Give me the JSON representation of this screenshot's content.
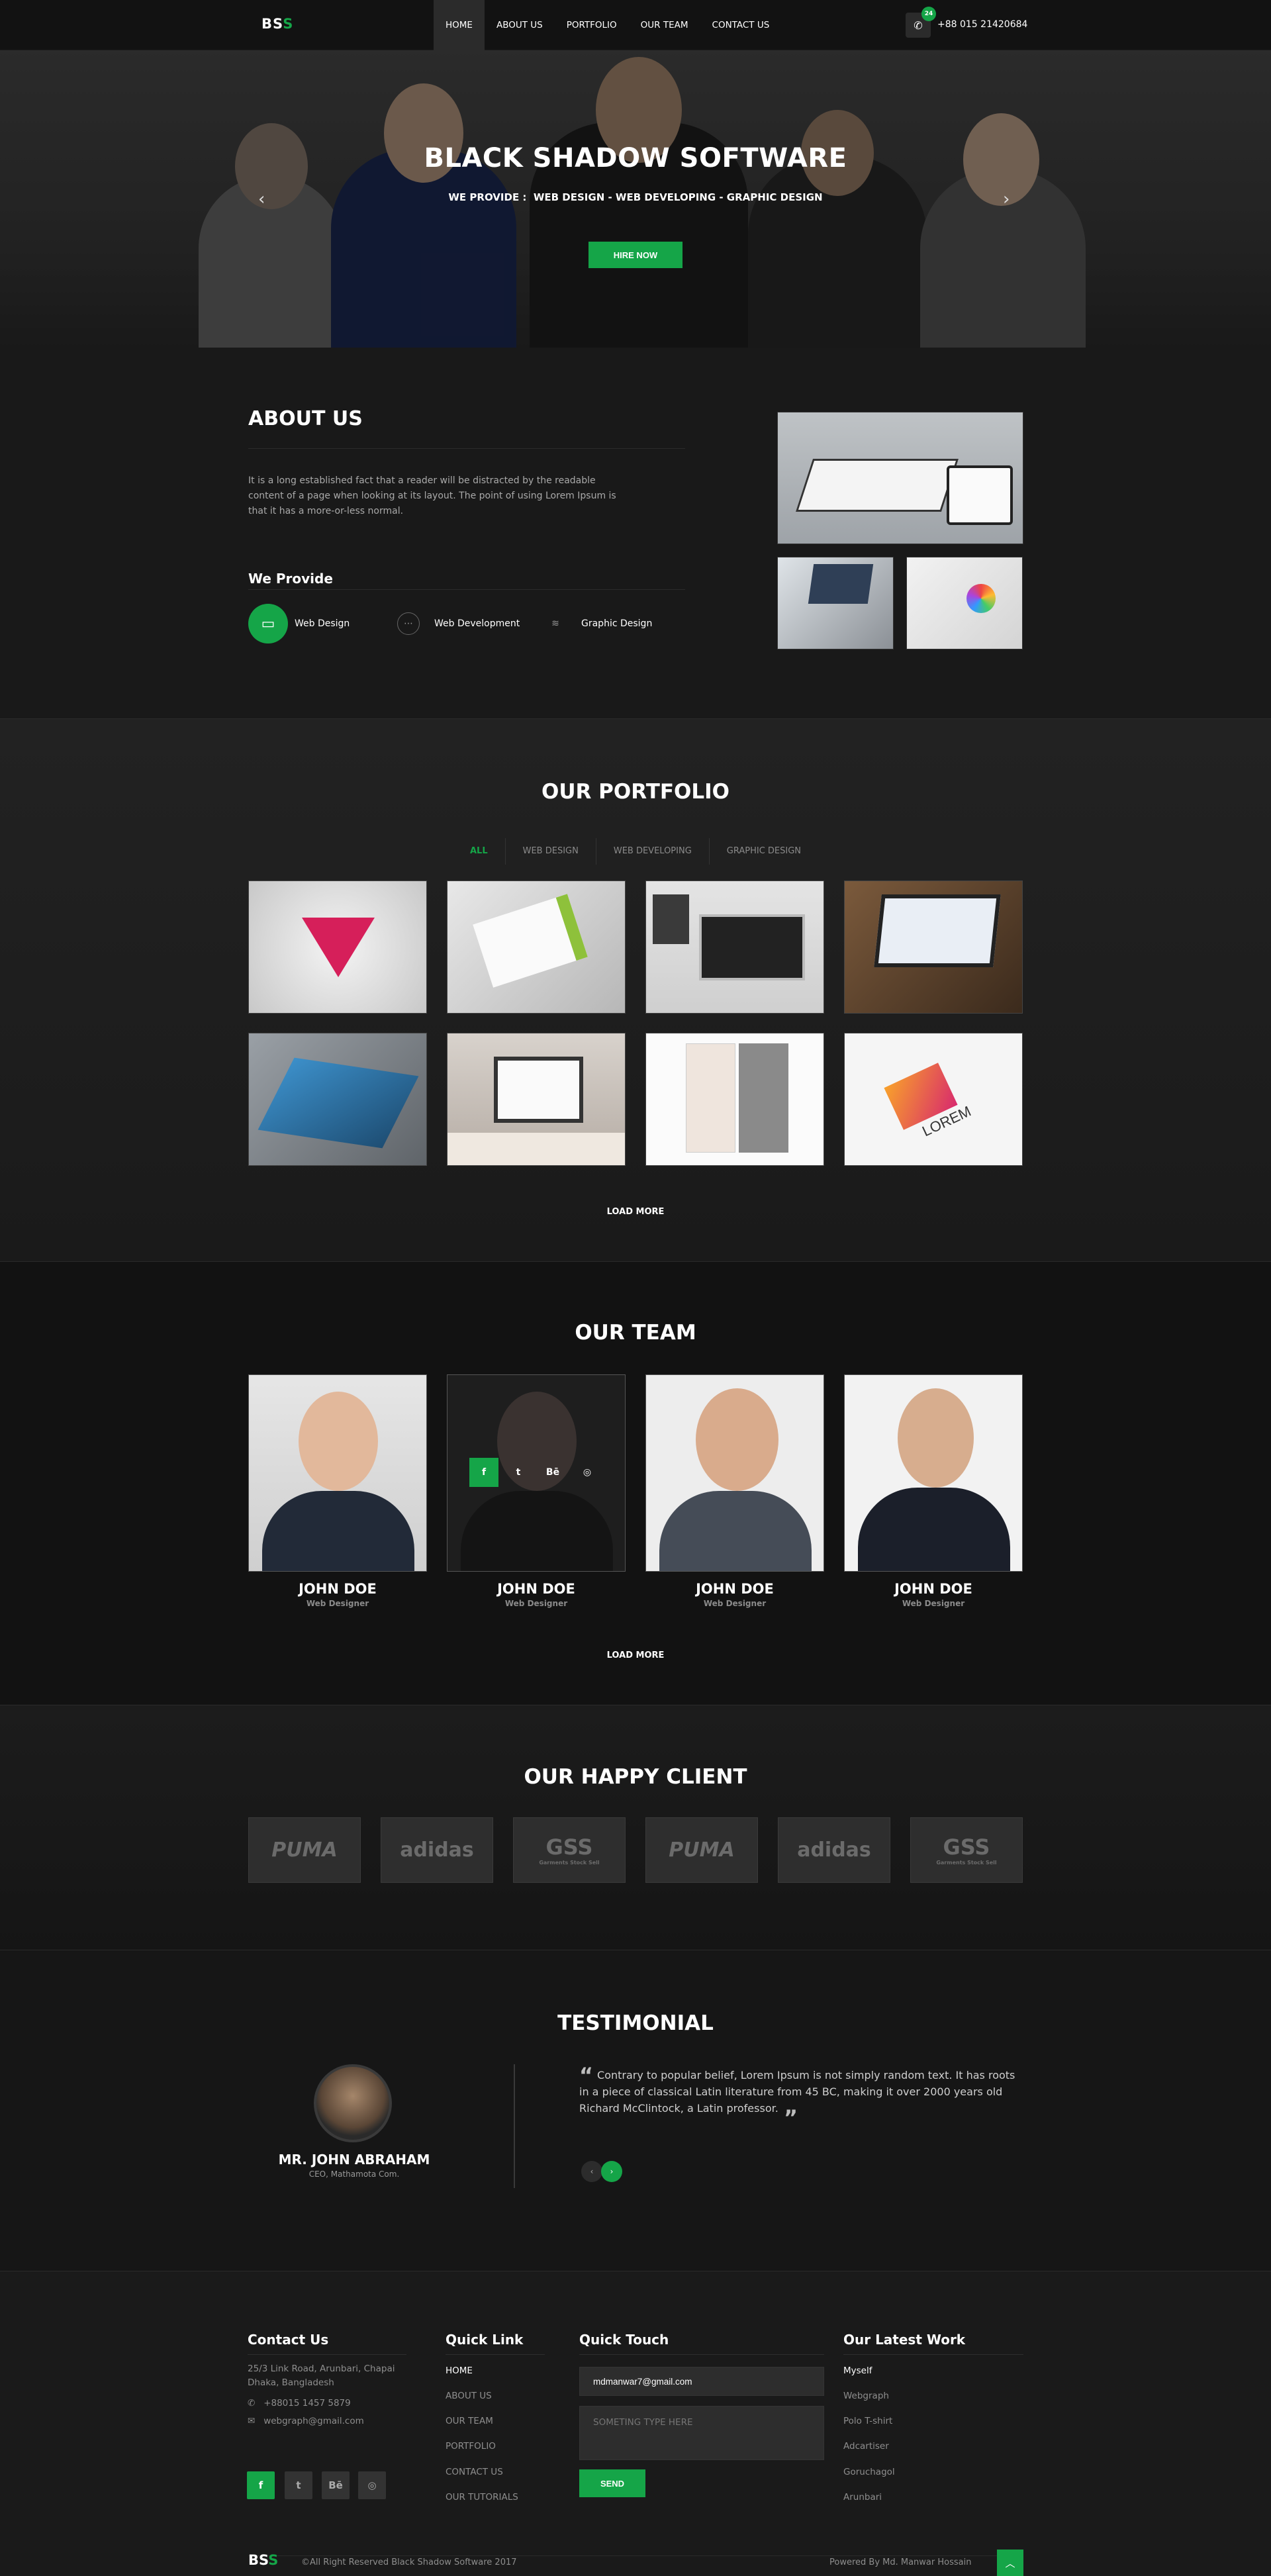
{
  "header": {
    "logo_main": "BS",
    "logo_accent": "S",
    "nav": [
      "HOME",
      "ABOUT US",
      "PORTFOLIO",
      "OUR TEAM",
      "CONTACT US"
    ],
    "phone_badge": "24",
    "phone": "+88 015 21420684"
  },
  "hero": {
    "title": "BLACK SHADOW SOFTWARE",
    "subtitle_label": "WE PROVIDE :",
    "subtitle_items": "WEB DESIGN - WEB DEVELOPING - GRAPHIC DESIGN",
    "cta": "HIRE NOW",
    "prev": "‹",
    "next": "›"
  },
  "about": {
    "title": "ABOUT US",
    "text": "It is a long established fact that a reader will be distracted by the readable content of a page when looking at its layout. The point of using Lorem Ipsum is that it has a more-or-less normal.",
    "provide_title": "We Provide",
    "provide": [
      "Web Design",
      "Web Development",
      "Graphic Design"
    ]
  },
  "portfolio": {
    "title": "OUR PORTFOLIO",
    "filters": [
      "ALL",
      "WEB DESIGN",
      "WEB DEVELOPING",
      "GRAPHIC DESIGN"
    ],
    "load_more": "LOAD MORE",
    "logo_text": "LOREM"
  },
  "team": {
    "title": "OUR TEAM",
    "members": [
      {
        "name": "JOHN DOE",
        "role": "Web Designer"
      },
      {
        "name": "JOHN DOE",
        "role": "Web Designer"
      },
      {
        "name": "JOHN DOE",
        "role": "Web Designer"
      },
      {
        "name": "JOHN DOE",
        "role": "Web Designer"
      }
    ],
    "social": [
      "f",
      "t",
      "Bē",
      "◎"
    ],
    "load_more": "LOAD MORE"
  },
  "clients": {
    "title": "OUR HAPPY CLIENT",
    "logos": [
      "PUMA",
      "adidas",
      "GSS",
      "PUMA",
      "adidas",
      "GSS"
    ],
    "gss_sub": "Garments Stock Sell"
  },
  "testimonial": {
    "title": "TESTIMONIAL",
    "name": "MR. JOHN ABRAHAM",
    "role": "CEO, Mathamota Com.",
    "quote": "Contrary to popular belief, Lorem Ipsum is not simply random text. It has roots in a piece of classical Latin literature from 45 BC, making it over 2000 years old Richard McClintock, a Latin professor.",
    "prev": "‹",
    "next": "›"
  },
  "footer": {
    "contact_title": "Contact Us",
    "address": "25/3 Link Road, Arunbari, Chapai Dhaka, Bangladesh",
    "phone": "+88015 1457 5879",
    "email": "webgraph@gmail.com",
    "social": [
      "f",
      "t",
      "Bē",
      "◎"
    ],
    "quick_title": "Quick Link",
    "quick_links": [
      "HOME",
      "ABOUT US",
      "OUR TEAM",
      "PORTFOLIO",
      "CONTACT US",
      "OUR TUTORIALS"
    ],
    "touch_title": "Quick Touch",
    "email_value": "mdmanwar7@gmail.com",
    "message_placeholder": "SOMETING TYPE HERE",
    "send": "SEND",
    "latest_title": "Our Latest Work",
    "latest": [
      "Myself",
      "Webgraph",
      "Polo T-shirt",
      "Adcartiser",
      "Goruchagol",
      "Arunbari"
    ],
    "copyright": "©All Right Reserved Black Shadow Software 2017",
    "powered": "Powered By Md. Manwar Hossain",
    "to_top": "︿"
  },
  "colors": {
    "accent": "#15a548",
    "background": "#121212"
  }
}
